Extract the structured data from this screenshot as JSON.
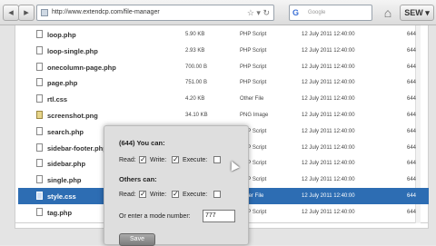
{
  "browser": {
    "back_label": "◂",
    "forward_label": "▸",
    "url": "http://www.extendcp.com/file-manager",
    "url_icons": "☆ ▾ ↻",
    "search_engine_logo": "G",
    "search_placeholder": "Google",
    "home_icon": "⌂",
    "toolbar_button": "SEW ▾"
  },
  "files": [
    {
      "name": "loop.php",
      "size": "5.90 KB",
      "type": "PHP Script",
      "date": "12 July 2011 12:40:00",
      "perm": "644",
      "icon": "file-icon"
    },
    {
      "name": "loop-single.php",
      "size": "2.93 KB",
      "type": "PHP Script",
      "date": "12 July 2011 12:40:00",
      "perm": "644",
      "icon": "file-icon"
    },
    {
      "name": "onecolumn-page.php",
      "size": "700.00 B",
      "type": "PHP Script",
      "date": "12 July 2011 12:40:00",
      "perm": "644",
      "icon": "file-icon"
    },
    {
      "name": "page.php",
      "size": "751.00 B",
      "type": "PHP Script",
      "date": "12 July 2011 12:40:00",
      "perm": "644",
      "icon": "file-icon"
    },
    {
      "name": "rtl.css",
      "size": "4.20 KB",
      "type": "Other File",
      "date": "12 July 2011 12:40:00",
      "perm": "644",
      "icon": "file-icon"
    },
    {
      "name": "screenshot.png",
      "size": "34.10 KB",
      "type": "PNG Image",
      "date": "12 July 2011 12:40:00",
      "perm": "644",
      "icon": "image-icon"
    },
    {
      "name": "search.php",
      "size": "",
      "type": "PHP Script",
      "date": "12 July 2011 12:40:00",
      "perm": "644",
      "icon": "file-icon"
    },
    {
      "name": "sidebar-footer.php",
      "size": "",
      "type": "PHP Script",
      "date": "12 July 2011 12:40:00",
      "perm": "644",
      "icon": "file-icon"
    },
    {
      "name": "sidebar.php",
      "size": "",
      "type": "PHP Script",
      "date": "12 July 2011 12:40:00",
      "perm": "644",
      "icon": "file-icon"
    },
    {
      "name": "single.php",
      "size": "",
      "type": "PHP Script",
      "date": "12 July 2011 12:40:00",
      "perm": "644",
      "icon": "file-icon"
    },
    {
      "name": "style.css",
      "size": "",
      "type": "Other File",
      "date": "12 July 2011 12:40:00",
      "perm": "644",
      "icon": "file-icon",
      "selected": true
    },
    {
      "name": "tag.php",
      "size": "",
      "type": "PHP Script",
      "date": "12 July 2011 12:40:00",
      "perm": "644",
      "icon": "file-icon"
    }
  ],
  "permissions_popup": {
    "you_can_label": "(644) You can:",
    "read_label": "Read:",
    "write_label": "Write:",
    "execute_label": "Execute:",
    "others_can_label": "Others can:",
    "mode_number_label": "Or enter a mode number:",
    "mode_value": "777",
    "save_label": "Save",
    "you_read": true,
    "you_write": true,
    "you_execute": false,
    "others_read": true,
    "others_write": true,
    "others_execute": false
  },
  "colors": {
    "selected_row": "#2d6db3"
  }
}
